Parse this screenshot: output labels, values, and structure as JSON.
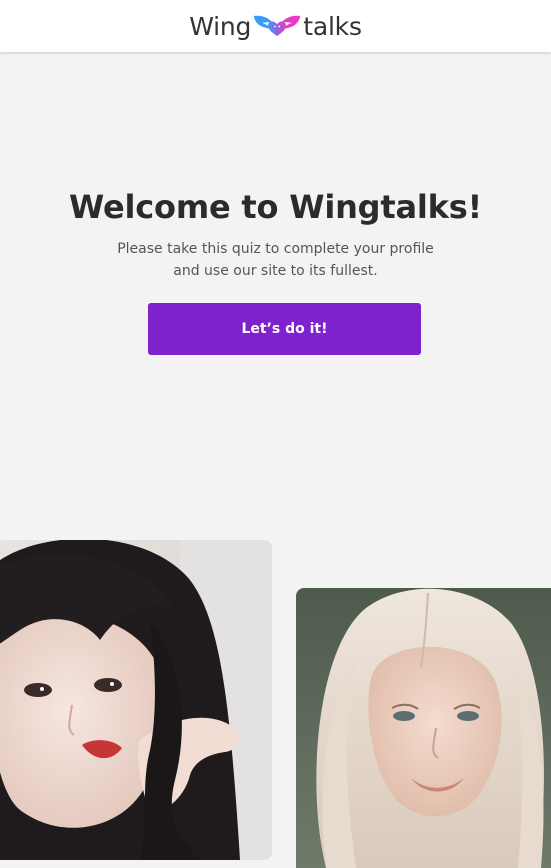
{
  "header": {
    "logo_left": "Wing",
    "logo_right": "talks",
    "logo_icon": "wings-heart-icon"
  },
  "hero": {
    "title": "Welcome to Wingtalks!",
    "subtitle_line1": "Please take this quiz to complete your profile",
    "subtitle_line2": "and use our site to its fullest."
  },
  "cta": {
    "label": "Let’s do it!"
  },
  "photos": [
    {
      "icon": "profile-photo-dark-hair"
    },
    {
      "icon": "profile-photo-blonde-hair"
    }
  ],
  "colors": {
    "brand_purple": "#7e22ce",
    "background": "#f3f3f3",
    "header_bg": "#ffffff",
    "title_text": "#2b2b2b",
    "wing_blue": "#3b9cf5",
    "wing_pink": "#e83bc4"
  }
}
